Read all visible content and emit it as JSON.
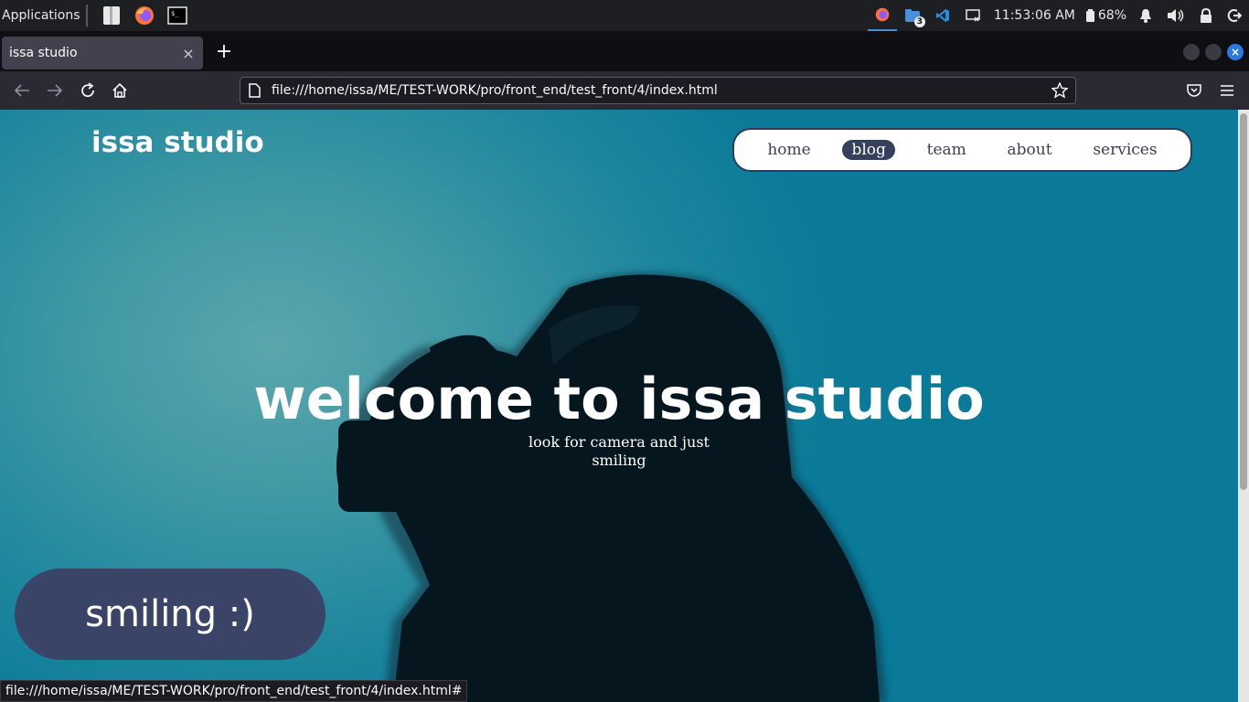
{
  "os_panel": {
    "applications_label": "Applications",
    "launchers": [
      "files-icon",
      "firefox-icon",
      "terminal-icon"
    ],
    "tray": {
      "firefox_icon": "firefox-icon",
      "files_badge": "3",
      "clock": "11:53:06 AM",
      "battery_percent": "68%"
    }
  },
  "browser": {
    "tab_title": "issa studio",
    "tab_close": "×",
    "new_tab": "+",
    "url": "file:///home/issa/ME/TEST-WORK/pro/front_end/test_front/4/index.html",
    "status_url": "file:///home/issa/ME/TEST-WORK/pro/front_end/test_front/4/index.html#"
  },
  "page": {
    "brand": "issa studio",
    "nav": [
      {
        "label": "home"
      },
      {
        "label": "blog",
        "active": true
      },
      {
        "label": "team"
      },
      {
        "label": "about"
      },
      {
        "label": "services"
      }
    ],
    "hero_title": "welcome to issa studio",
    "hero_subtitle": "look for camera and just smiling",
    "cta_label": "smiling :)"
  },
  "colors": {
    "nav_active_bg": "#33415f",
    "cta_bg": "#3a4466",
    "page_bg": "#0a7a98",
    "accent_blue": "#2c78e0"
  }
}
